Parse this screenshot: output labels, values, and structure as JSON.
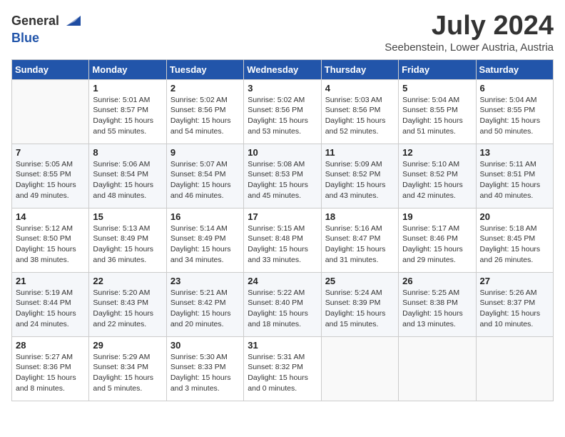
{
  "header": {
    "logo_general": "General",
    "logo_blue": "Blue",
    "month_year": "July 2024",
    "location": "Seebenstein, Lower Austria, Austria"
  },
  "weekdays": [
    "Sunday",
    "Monday",
    "Tuesday",
    "Wednesday",
    "Thursday",
    "Friday",
    "Saturday"
  ],
  "weeks": [
    [
      {
        "day": "",
        "info": ""
      },
      {
        "day": "1",
        "info": "Sunrise: 5:01 AM\nSunset: 8:57 PM\nDaylight: 15 hours\nand 55 minutes."
      },
      {
        "day": "2",
        "info": "Sunrise: 5:02 AM\nSunset: 8:56 PM\nDaylight: 15 hours\nand 54 minutes."
      },
      {
        "day": "3",
        "info": "Sunrise: 5:02 AM\nSunset: 8:56 PM\nDaylight: 15 hours\nand 53 minutes."
      },
      {
        "day": "4",
        "info": "Sunrise: 5:03 AM\nSunset: 8:56 PM\nDaylight: 15 hours\nand 52 minutes."
      },
      {
        "day": "5",
        "info": "Sunrise: 5:04 AM\nSunset: 8:55 PM\nDaylight: 15 hours\nand 51 minutes."
      },
      {
        "day": "6",
        "info": "Sunrise: 5:04 AM\nSunset: 8:55 PM\nDaylight: 15 hours\nand 50 minutes."
      }
    ],
    [
      {
        "day": "7",
        "info": "Sunrise: 5:05 AM\nSunset: 8:55 PM\nDaylight: 15 hours\nand 49 minutes."
      },
      {
        "day": "8",
        "info": "Sunrise: 5:06 AM\nSunset: 8:54 PM\nDaylight: 15 hours\nand 48 minutes."
      },
      {
        "day": "9",
        "info": "Sunrise: 5:07 AM\nSunset: 8:54 PM\nDaylight: 15 hours\nand 46 minutes."
      },
      {
        "day": "10",
        "info": "Sunrise: 5:08 AM\nSunset: 8:53 PM\nDaylight: 15 hours\nand 45 minutes."
      },
      {
        "day": "11",
        "info": "Sunrise: 5:09 AM\nSunset: 8:52 PM\nDaylight: 15 hours\nand 43 minutes."
      },
      {
        "day": "12",
        "info": "Sunrise: 5:10 AM\nSunset: 8:52 PM\nDaylight: 15 hours\nand 42 minutes."
      },
      {
        "day": "13",
        "info": "Sunrise: 5:11 AM\nSunset: 8:51 PM\nDaylight: 15 hours\nand 40 minutes."
      }
    ],
    [
      {
        "day": "14",
        "info": "Sunrise: 5:12 AM\nSunset: 8:50 PM\nDaylight: 15 hours\nand 38 minutes."
      },
      {
        "day": "15",
        "info": "Sunrise: 5:13 AM\nSunset: 8:49 PM\nDaylight: 15 hours\nand 36 minutes."
      },
      {
        "day": "16",
        "info": "Sunrise: 5:14 AM\nSunset: 8:49 PM\nDaylight: 15 hours\nand 34 minutes."
      },
      {
        "day": "17",
        "info": "Sunrise: 5:15 AM\nSunset: 8:48 PM\nDaylight: 15 hours\nand 33 minutes."
      },
      {
        "day": "18",
        "info": "Sunrise: 5:16 AM\nSunset: 8:47 PM\nDaylight: 15 hours\nand 31 minutes."
      },
      {
        "day": "19",
        "info": "Sunrise: 5:17 AM\nSunset: 8:46 PM\nDaylight: 15 hours\nand 29 minutes."
      },
      {
        "day": "20",
        "info": "Sunrise: 5:18 AM\nSunset: 8:45 PM\nDaylight: 15 hours\nand 26 minutes."
      }
    ],
    [
      {
        "day": "21",
        "info": "Sunrise: 5:19 AM\nSunset: 8:44 PM\nDaylight: 15 hours\nand 24 minutes."
      },
      {
        "day": "22",
        "info": "Sunrise: 5:20 AM\nSunset: 8:43 PM\nDaylight: 15 hours\nand 22 minutes."
      },
      {
        "day": "23",
        "info": "Sunrise: 5:21 AM\nSunset: 8:42 PM\nDaylight: 15 hours\nand 20 minutes."
      },
      {
        "day": "24",
        "info": "Sunrise: 5:22 AM\nSunset: 8:40 PM\nDaylight: 15 hours\nand 18 minutes."
      },
      {
        "day": "25",
        "info": "Sunrise: 5:24 AM\nSunset: 8:39 PM\nDaylight: 15 hours\nand 15 minutes."
      },
      {
        "day": "26",
        "info": "Sunrise: 5:25 AM\nSunset: 8:38 PM\nDaylight: 15 hours\nand 13 minutes."
      },
      {
        "day": "27",
        "info": "Sunrise: 5:26 AM\nSunset: 8:37 PM\nDaylight: 15 hours\nand 10 minutes."
      }
    ],
    [
      {
        "day": "28",
        "info": "Sunrise: 5:27 AM\nSunset: 8:36 PM\nDaylight: 15 hours\nand 8 minutes."
      },
      {
        "day": "29",
        "info": "Sunrise: 5:29 AM\nSunset: 8:34 PM\nDaylight: 15 hours\nand 5 minutes."
      },
      {
        "day": "30",
        "info": "Sunrise: 5:30 AM\nSunset: 8:33 PM\nDaylight: 15 hours\nand 3 minutes."
      },
      {
        "day": "31",
        "info": "Sunrise: 5:31 AM\nSunset: 8:32 PM\nDaylight: 15 hours\nand 0 minutes."
      },
      {
        "day": "",
        "info": ""
      },
      {
        "day": "",
        "info": ""
      },
      {
        "day": "",
        "info": ""
      }
    ]
  ]
}
